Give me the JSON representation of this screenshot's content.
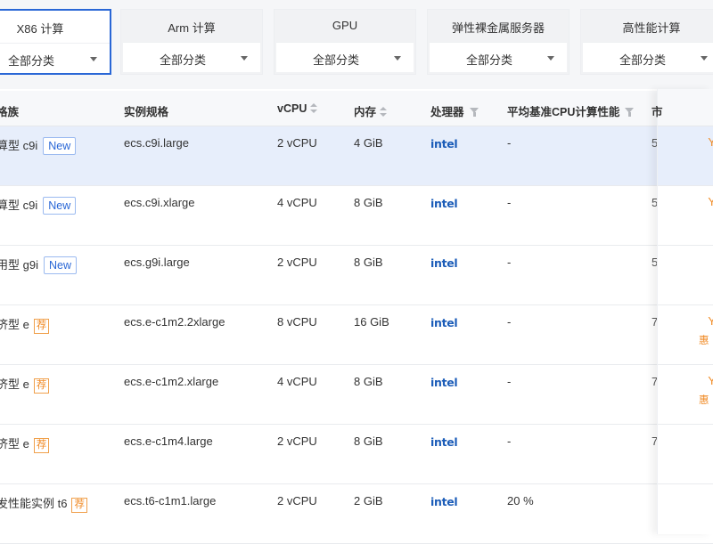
{
  "categories": [
    {
      "title": "X86 计算",
      "select": "全部分类",
      "active": true
    },
    {
      "title": "Arm 计算",
      "select": "全部分类",
      "active": false
    },
    {
      "title": "GPU",
      "select": "全部分类",
      "active": false
    },
    {
      "title": "弹性裸金属服务器",
      "select": "全部分类",
      "active": false
    },
    {
      "title": "高性能计算",
      "select": "全部分类",
      "active": false
    }
  ],
  "table": {
    "headers": {
      "family": "格族",
      "spec": "实例规格",
      "vcpu": "vCPU",
      "memory": "内存",
      "processor": "处理器",
      "perf": "平均基准CPU计算性能",
      "extra": "市"
    },
    "rows": [
      {
        "family": "算型 c9i",
        "badge": "New",
        "badge_type": "new",
        "spec": "ecs.c9i.large",
        "vcpu": "2 vCPU",
        "memory": "4 GiB",
        "processor": "intel",
        "perf": "-",
        "extra": "5",
        "price_mark": "Y",
        "promo": "",
        "selected": true
      },
      {
        "family": "算型 c9i",
        "badge": "New",
        "badge_type": "new",
        "spec": "ecs.c9i.xlarge",
        "vcpu": "4 vCPU",
        "memory": "8 GiB",
        "processor": "intel",
        "perf": "-",
        "extra": "5",
        "price_mark": "Y",
        "promo": "",
        "selected": false
      },
      {
        "family": "用型 g9i",
        "badge": "New",
        "badge_type": "new",
        "spec": "ecs.g9i.large",
        "vcpu": "2 vCPU",
        "memory": "8 GiB",
        "processor": "intel",
        "perf": "-",
        "extra": "5",
        "price_mark": "",
        "promo": "",
        "selected": false
      },
      {
        "family": "济型 e",
        "badge": "荐",
        "badge_type": "rec",
        "spec": "ecs.e-c1m2.2xlarge",
        "vcpu": "8 vCPU",
        "memory": "16 GiB",
        "processor": "intel",
        "perf": "-",
        "extra": "7",
        "price_mark": "Y",
        "promo": "惠",
        "selected": false
      },
      {
        "family": "济型 e",
        "badge": "荐",
        "badge_type": "rec",
        "spec": "ecs.e-c1m2.xlarge",
        "vcpu": "4 vCPU",
        "memory": "8 GiB",
        "processor": "intel",
        "perf": "-",
        "extra": "7",
        "price_mark": "Y",
        "promo": "惠",
        "selected": false
      },
      {
        "family": "济型 e",
        "badge": "荐",
        "badge_type": "rec",
        "spec": "ecs.e-c1m4.large",
        "vcpu": "2 vCPU",
        "memory": "8 GiB",
        "processor": "intel",
        "perf": "-",
        "extra": "7",
        "price_mark": "",
        "promo": "",
        "selected": false
      },
      {
        "family": "发性能实例 t6",
        "badge": "荐",
        "badge_type": "rec",
        "spec": "ecs.t6-c1m1.large",
        "vcpu": "2 vCPU",
        "memory": "2 GiB",
        "processor": "intel",
        "perf": "20 %",
        "extra": "",
        "price_mark": "",
        "promo": "",
        "selected": false
      }
    ]
  },
  "colors": {
    "accent": "#2a67d6",
    "selected_row": "#e7eefb",
    "recommend": "#f08a24",
    "intel_blue": "#1b5cb8"
  }
}
